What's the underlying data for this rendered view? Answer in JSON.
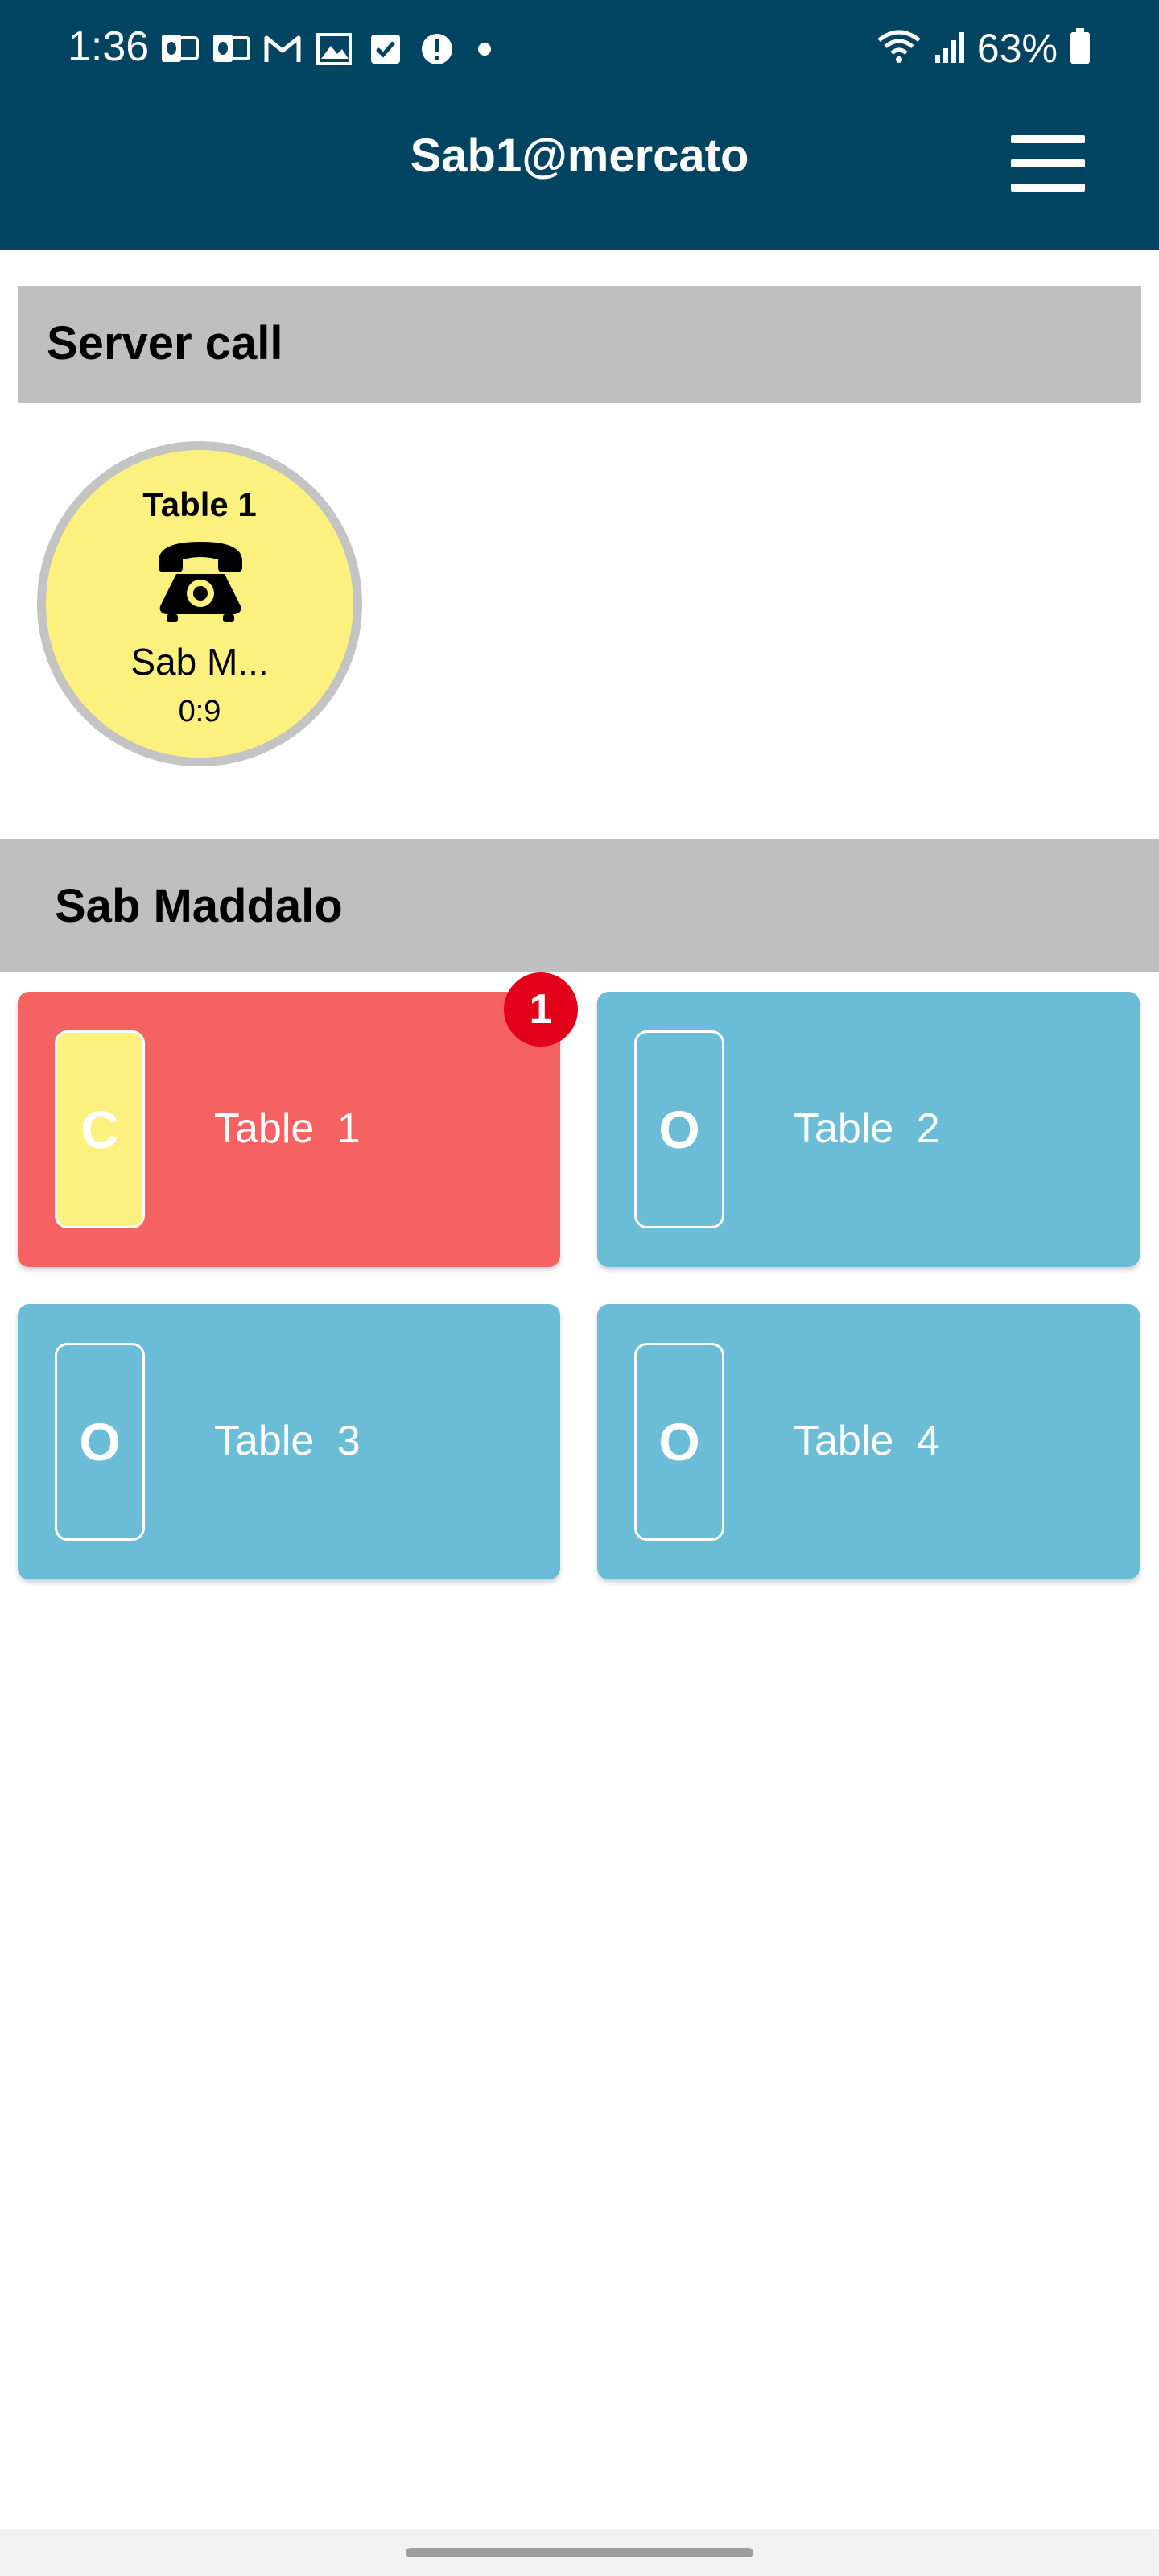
{
  "status_bar": {
    "time": "1:36",
    "notification_icons": [
      "outlook-icon",
      "outlook-icon",
      "gmail-icon",
      "photo-icon",
      "checkbox-icon",
      "alert-icon",
      "more-dot-icon"
    ],
    "battery_text": "63%"
  },
  "header": {
    "title": "Sab1@mercato",
    "menu_icon": "hamburger-menu-icon"
  },
  "server_call": {
    "section_title": "Server call",
    "call": {
      "table": "Table 1",
      "icon": "telephone-icon",
      "name": "Sab M...",
      "time": "0:9"
    }
  },
  "area": {
    "section_title": "Sab Maddalo",
    "tables": [
      {
        "status": "C",
        "label": "Table 1",
        "badge": "1",
        "color": "#f66161"
      },
      {
        "status": "O",
        "label": "Table 2",
        "color": "#6bbcd6"
      },
      {
        "status": "O",
        "label": "Table 3",
        "color": "#6bbcd6"
      },
      {
        "status": "O",
        "label": "Table 4",
        "color": "#6bbcd6"
      }
    ]
  },
  "colors": {
    "header_bg": "#004462",
    "section_bg": "#bfbfbf",
    "call_bg": "#fcf07e",
    "occupied_red": "#f66161",
    "open_blue": "#6bbcd6",
    "badge_red": "#e2001a"
  }
}
